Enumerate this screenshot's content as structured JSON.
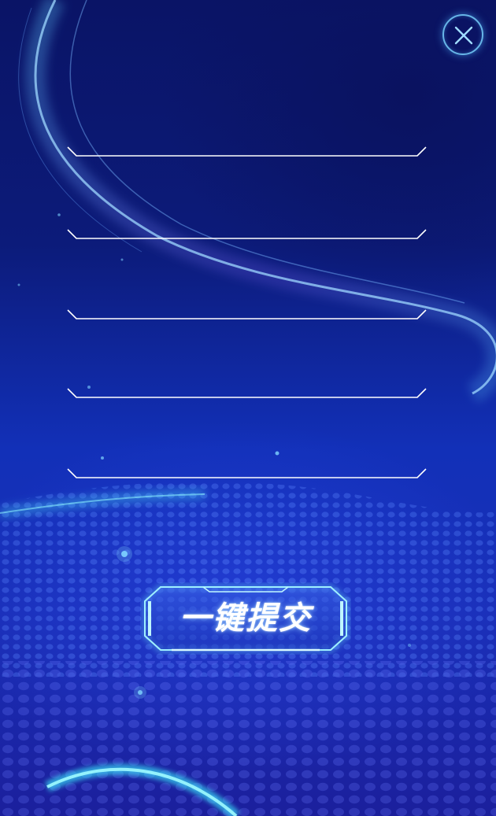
{
  "dialog": {
    "close_icon": "close-icon",
    "fields": [
      {
        "value": "",
        "placeholder": ""
      },
      {
        "value": "",
        "placeholder": ""
      },
      {
        "value": "",
        "placeholder": ""
      },
      {
        "value": "",
        "placeholder": ""
      },
      {
        "value": "",
        "placeholder": ""
      }
    ],
    "submit_label": "一键提交"
  },
  "colors": {
    "background_top": "#0a1466",
    "background_bottom": "#1b1f9c",
    "accent_cyan": "#5fe6ff",
    "underline": "#ffffff"
  }
}
